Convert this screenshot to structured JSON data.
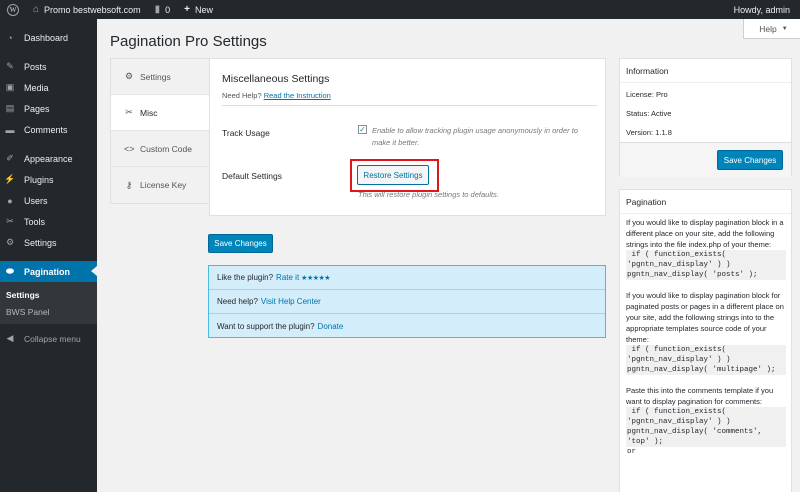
{
  "adminbar": {
    "site_name": "Promo bestwebsoft.com",
    "comments_count": "0",
    "new_label": "New",
    "howdy": "Howdy, admin"
  },
  "sidebar": {
    "items": [
      {
        "label": "Dashboard",
        "icon": "dashboard-icon"
      },
      {
        "label": "Posts",
        "icon": "pin-icon"
      },
      {
        "label": "Media",
        "icon": "media-icon"
      },
      {
        "label": "Pages",
        "icon": "pages-icon"
      },
      {
        "label": "Comments",
        "icon": "comment-icon"
      },
      {
        "label": "Appearance",
        "icon": "brush-icon"
      },
      {
        "label": "Plugins",
        "icon": "plug-icon"
      },
      {
        "label": "Users",
        "icon": "user-icon"
      },
      {
        "label": "Tools",
        "icon": "wrench-icon"
      },
      {
        "label": "Settings",
        "icon": "settings-icon"
      },
      {
        "label": "Pagination",
        "icon": "pagination-icon"
      }
    ],
    "submenu": [
      "Settings",
      "BWS Panel"
    ],
    "collapse_label": "Collapse menu"
  },
  "page": {
    "title": "Pagination Pro Settings",
    "help_label": "Help"
  },
  "tabs": [
    {
      "label": "Settings",
      "icon": "gear-icon"
    },
    {
      "label": "Misc",
      "icon": "wrench-icon"
    },
    {
      "label": "Custom Code",
      "icon": "code-icon"
    },
    {
      "label": "License Key",
      "icon": "key-icon"
    }
  ],
  "panel": {
    "title": "Miscellaneous Settings",
    "need_help": "Need Help?",
    "instruction_link": "Read the Instruction",
    "track_label": "Track Usage",
    "track_desc": "Enable to allow tracking plugin usage anonymously in order to make it better.",
    "default_label": "Default Settings",
    "restore_label": "Restore Settings",
    "restore_desc": "This will restore plugin settings to defaults."
  },
  "save_label": "Save Changes",
  "notices": {
    "like_text": "Like the plugin?",
    "rate_link": "Rate it",
    "stars": "★★★★★",
    "help_text": "Need help?",
    "help_link": "Visit Help Center",
    "support_text": "Want to support the plugin?",
    "donate_link": "Donate"
  },
  "info": {
    "title": "Information",
    "license": "License: Pro",
    "status": "Status: Active",
    "version": "Version: 1.1.8"
  },
  "pagination_box": {
    "title": "Pagination",
    "p1": "If you would like to display pagination block in a different place on your site, add the following strings into the file index.php of your theme:",
    "code1a": " if ( function_exists(",
    "code1b": "'pgntn_nav_display' ) )",
    "code1c": "pgntn_nav_display( 'posts' );",
    "p2": "If you would like to display pagination block for paginated posts or pages in a different place on your site, add the following strings into to the appropriate templates source code of your theme:",
    "code2a": " if ( function_exists(",
    "code2b": "'pgntn_nav_display' ) )",
    "code2c": "pgntn_nav_display( 'multipage' );",
    "p3": "Paste this into the comments template if you want to display pagination for comments:",
    "code3a": " if ( function_exists(",
    "code3b": "'pgntn_nav_display' ) )",
    "code3c": "pgntn_nav_display( 'comments',",
    "code3d": "'top' );",
    "code3e": "or"
  }
}
